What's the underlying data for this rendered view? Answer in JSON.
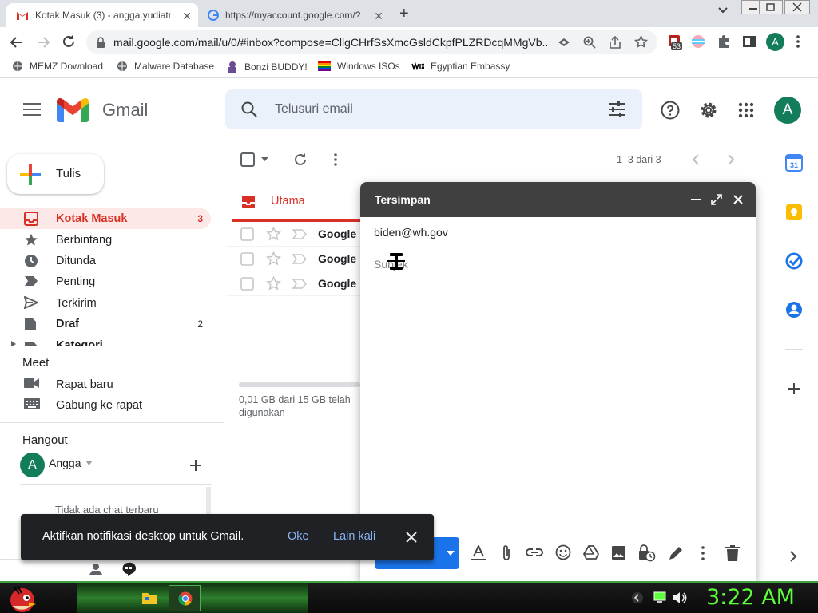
{
  "browser": {
    "tabs": [
      {
        "title": "Kotak Masuk (3) - angga.yudiatm",
        "close": "✕"
      },
      {
        "title": "https://myaccount.google.com/?",
        "close": "✕"
      }
    ],
    "new_tab": "+",
    "url": "mail.google.com/mail/u/0/#inbox?compose=CllgCHrfSsXmcGsldCkpfPLZRDcqMMgVb...",
    "extension_badge": "53",
    "profile_initial": "A",
    "bookmarks": [
      "MEMZ Download",
      "Malware Database",
      "Bonzi BUDDY!",
      "Windows ISOs",
      "Egyptian Embassy"
    ]
  },
  "gmail": {
    "logo_text": "Gmail",
    "search_placeholder": "Telusuri email",
    "account_initial": "A",
    "compose_label": "Tulis",
    "nav": [
      {
        "label": "Kotak Masuk",
        "count": "3"
      },
      {
        "label": "Berbintang",
        "count": ""
      },
      {
        "label": "Ditunda",
        "count": ""
      },
      {
        "label": "Penting",
        "count": ""
      },
      {
        "label": "Terkirim",
        "count": ""
      },
      {
        "label": "Draf",
        "count": "2"
      },
      {
        "label": "Kategori",
        "count": ""
      }
    ],
    "meet": {
      "title": "Meet",
      "items": [
        "Rapat baru",
        "Gabung ke rapat"
      ]
    },
    "hangout": {
      "title": "Hangout",
      "user_initial": "A",
      "user": "Angga",
      "empty": "Tidak ada chat terbaru"
    },
    "list": {
      "pagination": "1–3 dari 3",
      "tab_label": "Utama",
      "rows": [
        "Google",
        "Google",
        "Google"
      ],
      "storage": "0,01 GB dari 15 GB telah digunakan"
    }
  },
  "compose": {
    "title": "Tersimpan",
    "to": "biden@wh.gov",
    "subject_placeholder": "Subjek"
  },
  "snackbar": {
    "message": "Aktifkan notifikasi desktop untuk Gmail.",
    "ok": "Oke",
    "later": "Lain kali"
  },
  "taskbar": {
    "clock": "3:22 AM"
  },
  "colors": {
    "gmail_red": "#d93025",
    "primary_blue": "#0b57d0",
    "compose_head": "#404040",
    "clock_green": "#5dff3a"
  }
}
